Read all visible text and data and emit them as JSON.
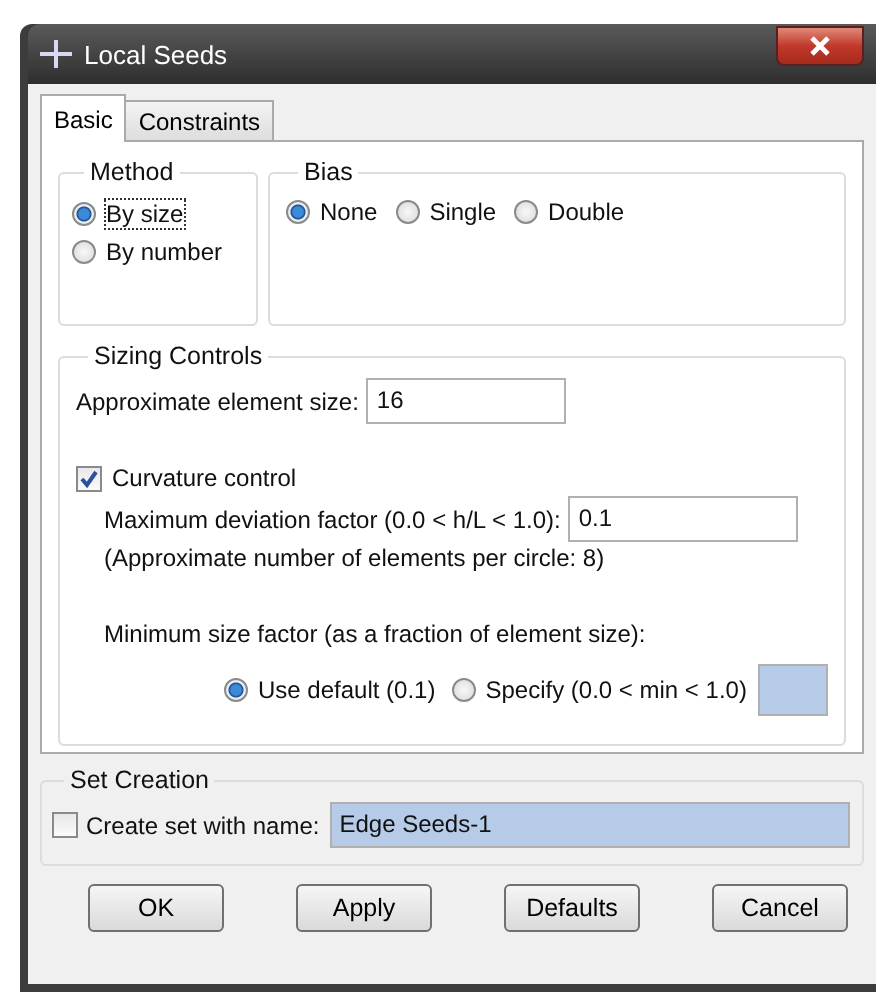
{
  "window": {
    "title": "Local Seeds"
  },
  "tabs": [
    {
      "label": "Basic",
      "selected": true
    },
    {
      "label": "Constraints",
      "selected": false
    }
  ],
  "method": {
    "title": "Method",
    "options": [
      {
        "label": "By size",
        "selected": true
      },
      {
        "label": "By number",
        "selected": false
      }
    ]
  },
  "bias": {
    "title": "Bias",
    "options": [
      {
        "label": "None",
        "selected": true
      },
      {
        "label": "Single",
        "selected": false
      },
      {
        "label": "Double",
        "selected": false
      }
    ]
  },
  "sizing": {
    "title": "Sizing Controls",
    "element_size": {
      "label": "Approximate element size:",
      "value": "16"
    },
    "curvature": {
      "label": "Curvature control",
      "checked": true
    },
    "deviation": {
      "label": "Maximum deviation factor (0.0 < h/L < 1.0):",
      "value": "0.1"
    },
    "note": "(Approximate number of elements per circle: 8)",
    "min_size": {
      "label": "Minimum size factor (as a fraction of element size):",
      "options": [
        {
          "label": "Use default (0.1)",
          "selected": true
        },
        {
          "label": "Specify (0.0 < min < 1.0)",
          "selected": false
        }
      ],
      "field_disabled": true
    }
  },
  "set_creation": {
    "title": "Set Creation",
    "checkbox": {
      "label": "Create set with name:",
      "checked": false
    },
    "field": {
      "value": "Edge Seeds-1",
      "disabled": true
    }
  },
  "buttons": [
    "OK",
    "Apply",
    "Defaults",
    "Cancel"
  ]
}
